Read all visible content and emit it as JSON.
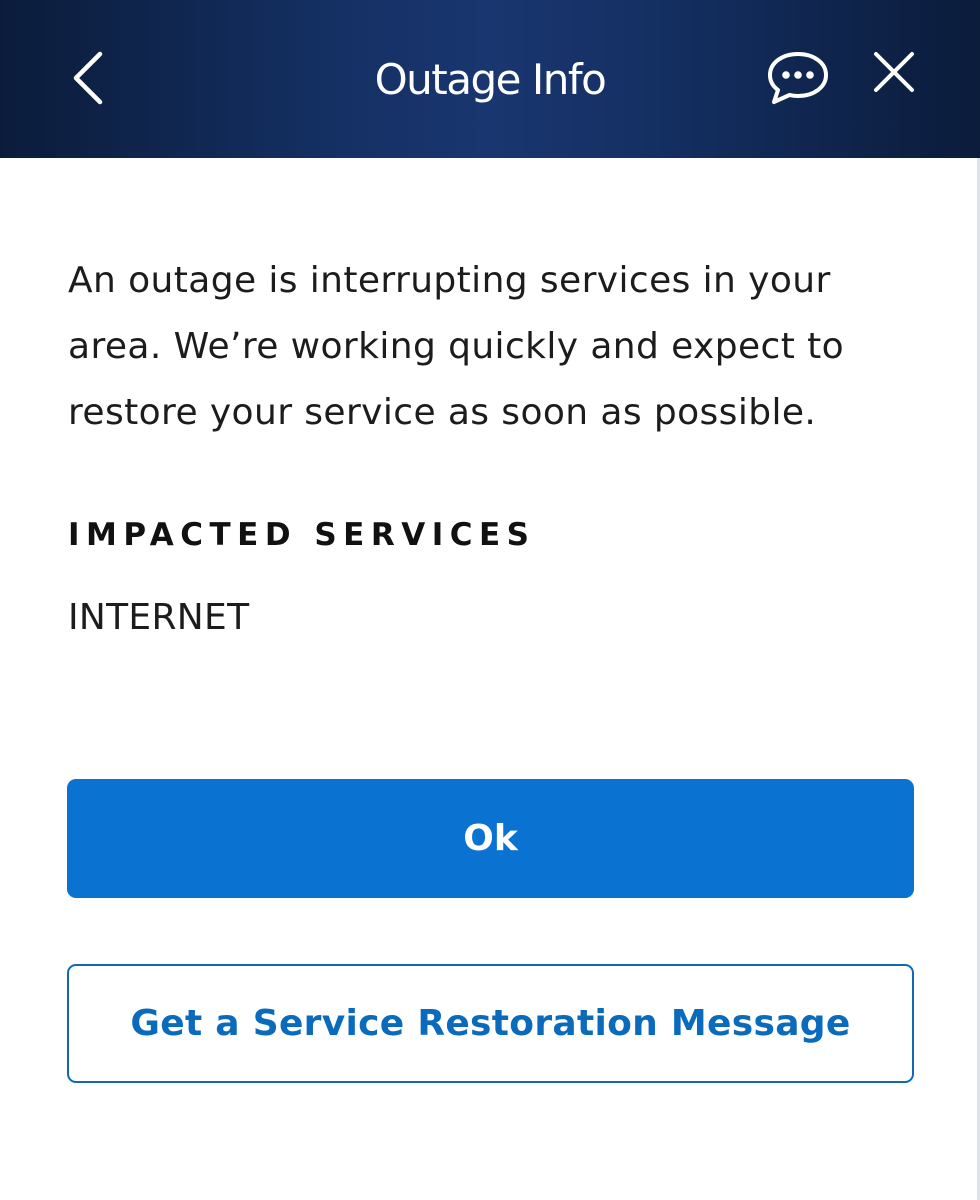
{
  "header": {
    "title": "Outage Info",
    "background": "#0f2650",
    "icons": {
      "back": "chevron-left-icon",
      "chat": "chat-bubble-icon",
      "close": "close-icon"
    }
  },
  "main": {
    "message": "An outage is interrupting services in your area. We’re working quickly and expect to restore your service as soon as possible.",
    "impacted_heading": "IMPACTED SERVICES",
    "impacted_services": [
      "INTERNET"
    ]
  },
  "actions": {
    "ok_label": "Ok",
    "restoration_label": "Get a Service Restoration Message",
    "primary_color": "#0a73d2",
    "secondary_color": "#0a6bbd"
  }
}
